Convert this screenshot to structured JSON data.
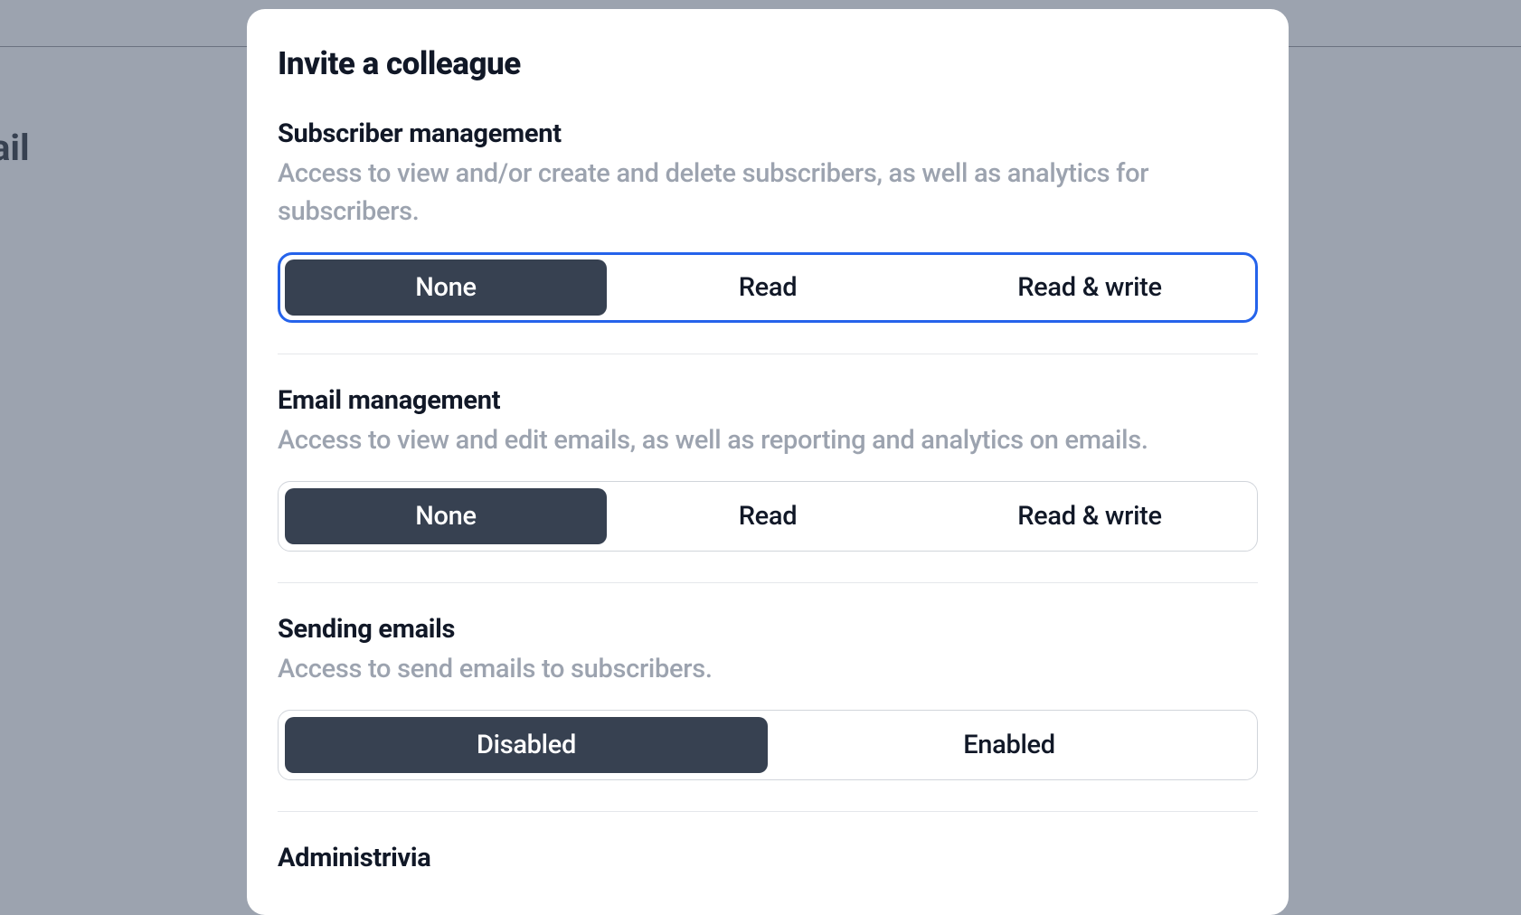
{
  "backdrop": {
    "partial_text": "ail"
  },
  "modal": {
    "title": "Invite a colleague",
    "sections": [
      {
        "title": "Subscriber management",
        "description": "Access to view and/or create and delete subscribers, as well as analytics for subscribers.",
        "options": [
          "None",
          "Read",
          "Read & write"
        ],
        "selected_index": 0,
        "focused": true
      },
      {
        "title": "Email management",
        "description": "Access to view and edit emails, as well as reporting and analytics on emails.",
        "options": [
          "None",
          "Read",
          "Read & write"
        ],
        "selected_index": 0,
        "focused": false
      },
      {
        "title": "Sending emails",
        "description": "Access to send emails to subscribers.",
        "options": [
          "Disabled",
          "Enabled"
        ],
        "selected_index": 0,
        "focused": false
      },
      {
        "title": "Administrivia",
        "description": "",
        "options": [],
        "selected_index": 0,
        "focused": false
      }
    ]
  }
}
